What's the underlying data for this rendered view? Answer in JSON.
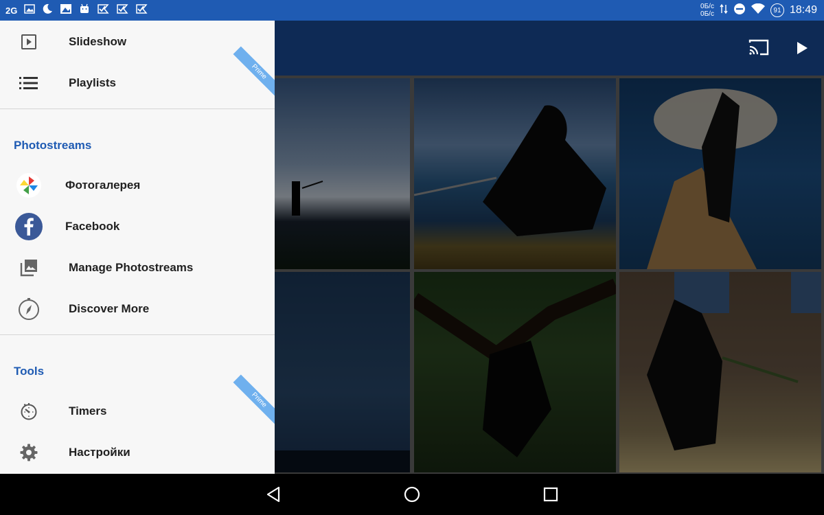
{
  "status_bar": {
    "left_text": "2G",
    "net_up": "0Б/с",
    "net_down": "0Б/с",
    "battery": "91",
    "time": "18:49",
    "icons": [
      "image-icon",
      "moon-icon",
      "photo-icon",
      "android-icon",
      "check-flag-icon",
      "check-flag-icon",
      "check-flag-icon"
    ],
    "right_icons": [
      "data-arrows-icon",
      "dnd-icon",
      "wifi-icon"
    ]
  },
  "toolbar": {
    "icons": [
      "cast-icon",
      "play-icon"
    ]
  },
  "drawer": {
    "items": [
      {
        "label": "Slideshow",
        "icon": "slideshow-icon"
      },
      {
        "label": "Playlists",
        "icon": "list-icon",
        "badge": "Prime"
      }
    ],
    "sections": [
      {
        "title": "Photostreams",
        "items": [
          {
            "label": "Фотогалерея",
            "icon": "pinwheel-icon"
          },
          {
            "label": "Facebook",
            "icon": "facebook-icon"
          },
          {
            "label": "Manage Photostreams",
            "icon": "photo-library-icon"
          },
          {
            "label": "Discover More",
            "icon": "compass-icon"
          }
        ]
      },
      {
        "title": "Tools",
        "items": [
          {
            "label": "Timers",
            "icon": "timer-icon",
            "badge": "Prime"
          },
          {
            "label": "Настройки",
            "icon": "gear-icon"
          }
        ]
      }
    ]
  },
  "colors": {
    "accent": "#1f5bb3",
    "toolbar": "#0e2a55",
    "prime_ribbon": "#6fb0ee"
  },
  "nav_bar": {
    "icons": [
      "back-icon",
      "home-icon",
      "recents-icon"
    ]
  }
}
